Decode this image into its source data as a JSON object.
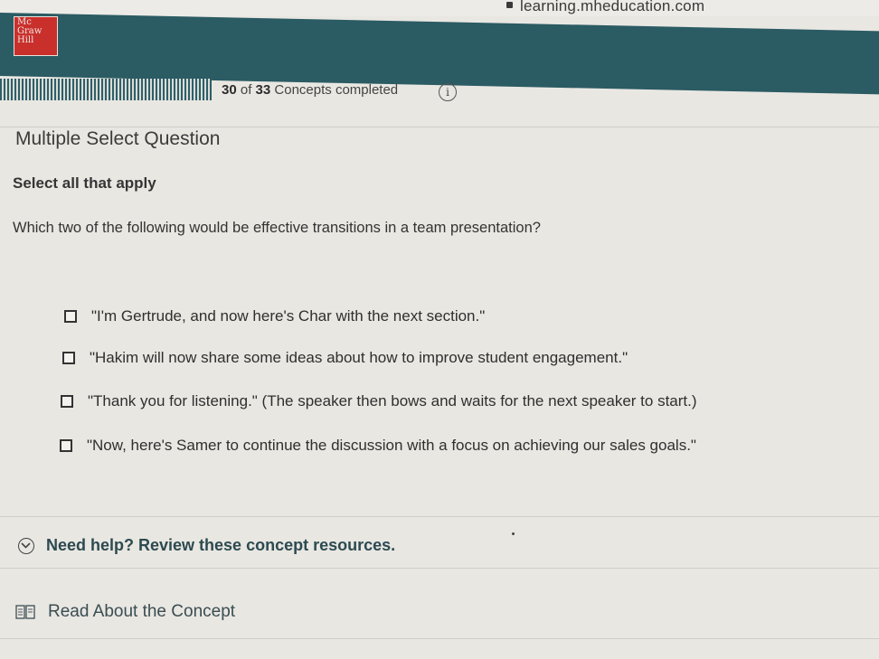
{
  "browser": {
    "url_fragment": "learning.mheducation.com"
  },
  "header": {
    "logo_lines": [
      "Mc",
      "Graw",
      "Hill"
    ],
    "bar_color": "#2b5b63"
  },
  "progress": {
    "completed": "30",
    "of_label": "of",
    "total": "33",
    "suffix": "Concepts completed",
    "fraction": 0.909,
    "info_icon": "info-icon"
  },
  "question": {
    "type_title": "Multiple Select Question",
    "instruction": "Select all that apply",
    "prompt": "Which two of the following would be effective transitions in a team presentation?",
    "options": [
      {
        "label": "\"I'm Gertrude, and now here's Char with the next section.\"",
        "checked": false
      },
      {
        "label": "\"Hakim will now share some ideas about how to improve student engagement.\"",
        "checked": false
      },
      {
        "label": "\"Thank you for listening.\" (The speaker then bows and waits for the next speaker to start.)",
        "checked": false
      },
      {
        "label": "\"Now, here's Samer to continue the discussion with a focus on achieving our sales goals.\"",
        "checked": false
      }
    ]
  },
  "help": {
    "toggle_label": "Need help? Review these concept resources.",
    "toggle_icon": "chevron-down-icon",
    "read_label": "Read About the Concept",
    "read_icon": "book-icon"
  }
}
